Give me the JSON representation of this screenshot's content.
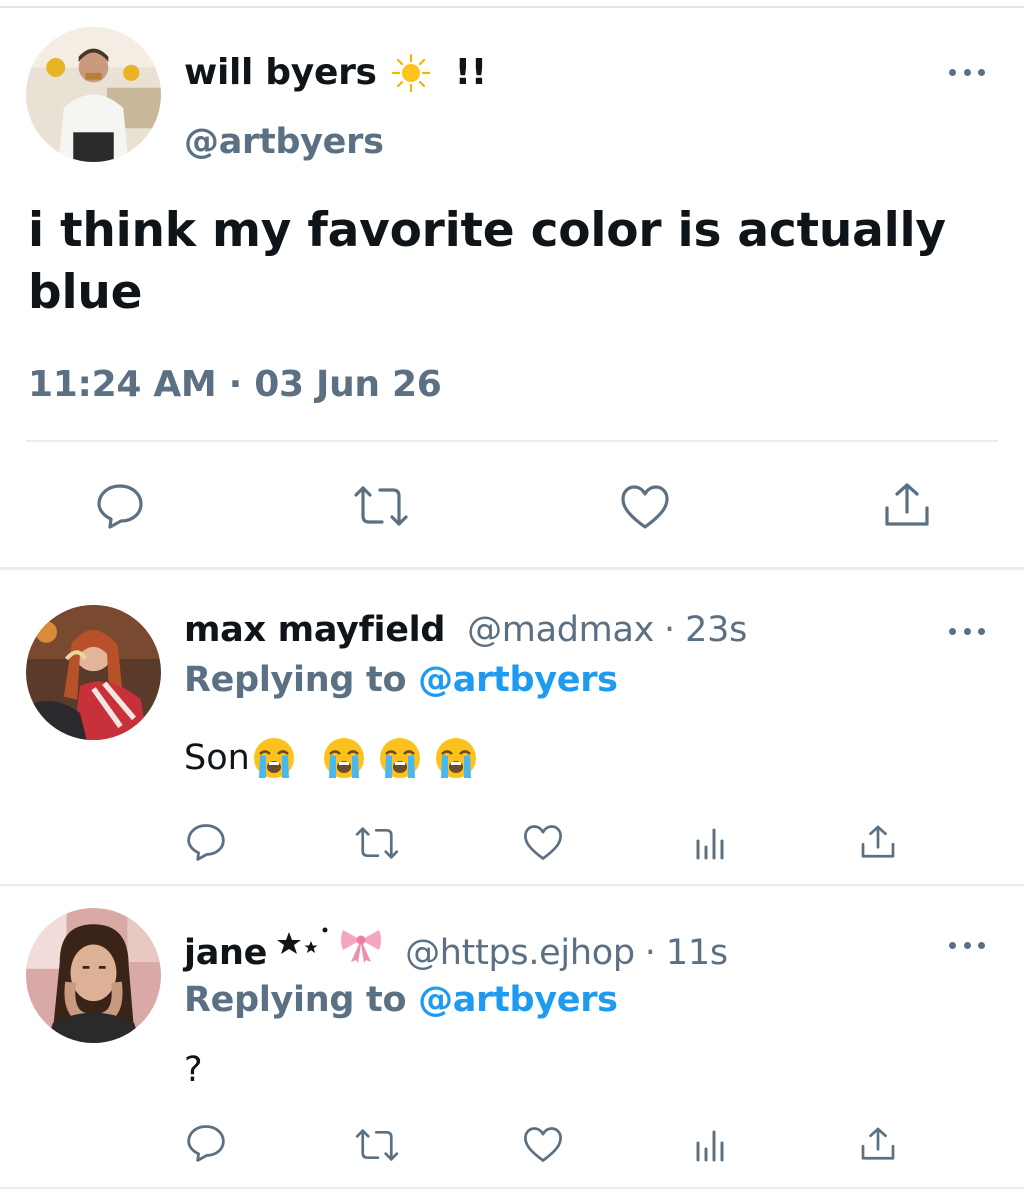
{
  "main_tweet": {
    "display_name": "will byers",
    "name_emoji": "sun-icon",
    "name_suffix": "!!",
    "handle": "@artbyers",
    "text": "i think my favorite color is actually blue",
    "timestamp": "11:24 AM · 03 Jun 26",
    "actions": [
      "reply-icon",
      "retweet-icon",
      "like-icon",
      "share-icon"
    ]
  },
  "replies": [
    {
      "display_name": "max mayfield",
      "handle": "@madmax",
      "dot": "·",
      "time": "23s",
      "replying_prefix": "Replying to",
      "replying_to": "@artbyers",
      "text": "Son",
      "emojis": [
        "loudly-crying-face-icon",
        "loudly-crying-face-icon",
        "loudly-crying-face-icon",
        "loudly-crying-face-icon"
      ],
      "actions": [
        "reply-icon",
        "retweet-icon",
        "like-icon",
        "analytics-icon",
        "share-icon"
      ]
    },
    {
      "display_name": "jane",
      "name_decorations": [
        "black-star-icon",
        "small-star-icon",
        "ribbon-icon"
      ],
      "handle": "@https.ejhop",
      "dot": "·",
      "time": "11s",
      "replying_prefix": "Replying to",
      "replying_to": "@artbyers",
      "text": "?",
      "actions": [
        "reply-icon",
        "retweet-icon",
        "like-icon",
        "analytics-icon",
        "share-icon"
      ]
    }
  ],
  "colors": {
    "text_primary": "#0f1419",
    "text_secondary": "#5b7083",
    "link": "#1d9bf0",
    "divider": "#e6ecf0"
  }
}
